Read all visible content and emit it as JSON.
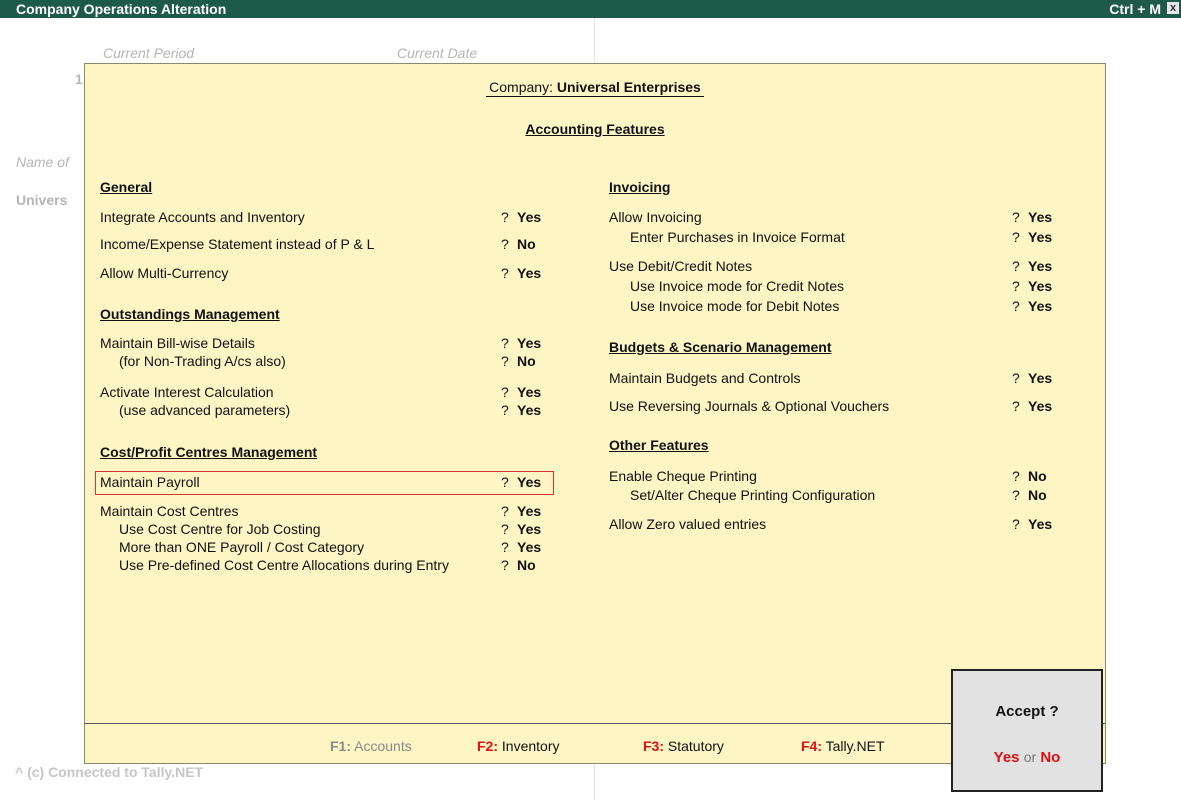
{
  "title_bar": {
    "title": "Company Operations  Alteration",
    "shortcut": "Ctrl + M",
    "close": "x"
  },
  "background": {
    "current_period_label": "Current Period",
    "current_date_label": "Current Date",
    "period_fragment": "1",
    "name_label": "Name of",
    "company_fragment": "Univers",
    "status": "^ (c) Connected to Tally.NET"
  },
  "panel": {
    "company_label": "Company:",
    "company_name": "Universal Enterprises",
    "features_title": "Accounting Features",
    "left": {
      "general_heading": "General",
      "general": [
        {
          "label": "Integrate Accounts and Inventory",
          "q": "?",
          "value": "Yes"
        },
        {
          "label": "Income/Expense Statement instead of P & L",
          "q": "?",
          "value": "No"
        },
        {
          "label": "Allow Multi-Currency",
          "q": "?",
          "value": "Yes"
        }
      ],
      "outstandings_heading": "Outstandings Management",
      "outstandings": [
        {
          "label": "Maintain Bill-wise Details",
          "q": "?",
          "value": "Yes"
        },
        {
          "label": "(for Non-Trading A/cs also)",
          "q": "?",
          "value": "No"
        },
        {
          "label": "Activate Interest Calculation",
          "q": "?",
          "value": "Yes"
        },
        {
          "label": "(use advanced parameters)",
          "q": "?",
          "value": "Yes"
        }
      ],
      "cost_heading": "Cost/Profit Centres Management",
      "cost": [
        {
          "label": "Maintain Payroll",
          "q": "?",
          "value": "Yes"
        },
        {
          "label": "Maintain Cost Centres",
          "q": "?",
          "value": "Yes"
        },
        {
          "label": "Use Cost Centre for Job Costing",
          "q": "?",
          "value": "Yes"
        },
        {
          "label": "More than ONE Payroll / Cost Category",
          "q": "?",
          "value": "Yes"
        },
        {
          "label": "Use Pre-defined Cost Centre Allocations during Entry",
          "q": "?",
          "value": "No"
        }
      ]
    },
    "right": {
      "invoicing_heading": "Invoicing",
      "invoicing": [
        {
          "label": "Allow Invoicing",
          "q": "?",
          "value": "Yes"
        },
        {
          "label": "Enter Purchases in Invoice Format",
          "q": "?",
          "value": "Yes"
        },
        {
          "label": "Use Debit/Credit Notes",
          "q": "?",
          "value": "Yes"
        },
        {
          "label": "Use Invoice mode for Credit Notes",
          "q": "?",
          "value": "Yes"
        },
        {
          "label": "Use Invoice mode for Debit Notes",
          "q": "?",
          "value": "Yes"
        }
      ],
      "budgets_heading": "Budgets & Scenario Management",
      "budgets": [
        {
          "label": "Maintain Budgets and Controls",
          "q": "?",
          "value": "Yes"
        },
        {
          "label": "Use Reversing Journals & Optional Vouchers",
          "q": "?",
          "value": "Yes"
        }
      ],
      "other_heading": "Other Features",
      "other": [
        {
          "label": "Enable Cheque Printing",
          "q": "?",
          "value": "No"
        },
        {
          "label": "Set/Alter Cheque Printing Configuration",
          "q": "?",
          "value": "No"
        },
        {
          "label": "Allow Zero valued entries",
          "q": "?",
          "value": "Yes"
        }
      ]
    },
    "footer": [
      {
        "key": "F1:",
        "label": "Accounts",
        "state": "disabled"
      },
      {
        "key": "F2:",
        "label": "Inventory",
        "state": "enabled"
      },
      {
        "key": "F3:",
        "label": "Statutory",
        "state": "enabled"
      },
      {
        "key": "F4:",
        "label": "Tally.NET",
        "state": "enabled"
      }
    ]
  },
  "accept": {
    "question": "Accept ?",
    "yes": "Yes",
    "or": "or",
    "no": "No"
  },
  "colors": {
    "title_bar": "#1e5a4a",
    "panel": "#fdf5c4",
    "hotkey_red": "#e01010",
    "highlight_border": "#d63333"
  }
}
